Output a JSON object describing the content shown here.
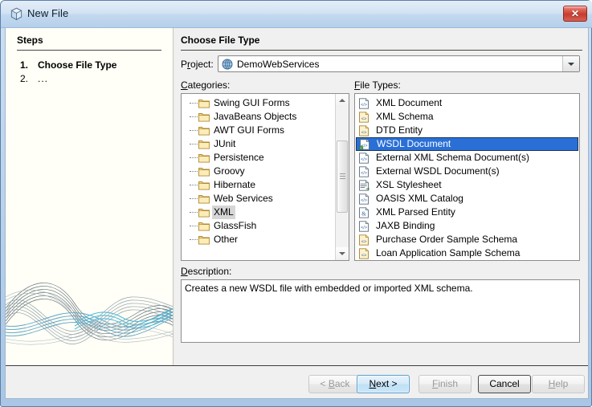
{
  "window": {
    "title": "New File",
    "title_icon": "cube-icon",
    "close_label": "✕"
  },
  "steps": {
    "heading": "Steps",
    "items": [
      {
        "num": "1.",
        "label": "Choose File Type"
      },
      {
        "num": "2.",
        "label": "..."
      }
    ]
  },
  "content": {
    "heading": "Choose File Type",
    "project": {
      "label_pre": "P",
      "label_mn": "r",
      "label_post": "oject:",
      "value": "DemoWebServices",
      "icon": "globe-icon"
    },
    "categories": {
      "label_mn": "C",
      "label_post": "ategories:",
      "selected": "XML",
      "items": [
        "Swing GUI Forms",
        "JavaBeans Objects",
        "AWT GUI Forms",
        "JUnit",
        "Persistence",
        "Groovy",
        "Hibernate",
        "Web Services",
        "XML",
        "GlassFish",
        "Other"
      ]
    },
    "filetypes": {
      "label_mn": "F",
      "label_post": "ile Types:",
      "selected": "WSDL Document",
      "items": [
        {
          "label": "XML Document",
          "icon": "xml-doc-icon"
        },
        {
          "label": "XML Schema",
          "icon": "xml-schema-icon"
        },
        {
          "label": "DTD Entity",
          "icon": "dtd-entity-icon"
        },
        {
          "label": "WSDL Document",
          "icon": "wsdl-doc-icon"
        },
        {
          "label": "External XML Schema Document(s)",
          "icon": "xml-doc-icon"
        },
        {
          "label": "External WSDL Document(s)",
          "icon": "xml-doc-icon"
        },
        {
          "label": "XSL Stylesheet",
          "icon": "xsl-stylesheet-icon"
        },
        {
          "label": "OASIS XML Catalog",
          "icon": "xml-doc-icon"
        },
        {
          "label": "XML Parsed Entity",
          "icon": "xml-entity-icon"
        },
        {
          "label": "JAXB Binding",
          "icon": "xml-doc-icon"
        },
        {
          "label": "Purchase Order Sample Schema",
          "icon": "xml-schema-icon"
        },
        {
          "label": "Loan Application Sample Schema",
          "icon": "xml-schema-icon"
        }
      ]
    },
    "description": {
      "label_mn": "D",
      "label_post": "escription:",
      "text": "Creates a new WSDL file with embedded or imported XML schema."
    }
  },
  "buttons": [
    {
      "id": "back",
      "pre": "< ",
      "mn": "B",
      "post": "ack",
      "state": "disabled"
    },
    {
      "id": "next",
      "pre": "",
      "mn": "N",
      "post": "ext >",
      "state": "default"
    },
    {
      "id": "finish",
      "pre": "",
      "mn": "F",
      "post": "inish",
      "state": "disabled"
    },
    {
      "id": "cancel",
      "pre": "",
      "mn": "",
      "post": "Cancel",
      "state": "focused"
    },
    {
      "id": "help",
      "pre": "",
      "mn": "H",
      "post": "elp",
      "state": "disabled"
    }
  ],
  "colors": {
    "selection_blue": "#2a6fd6",
    "selection_gray": "#d6d6d6",
    "titlebar_blue": "#c2d8ef",
    "close_red": "#c43d2f",
    "panel_gray": "#f0f0f0",
    "steps_cream": "#fffff7"
  }
}
